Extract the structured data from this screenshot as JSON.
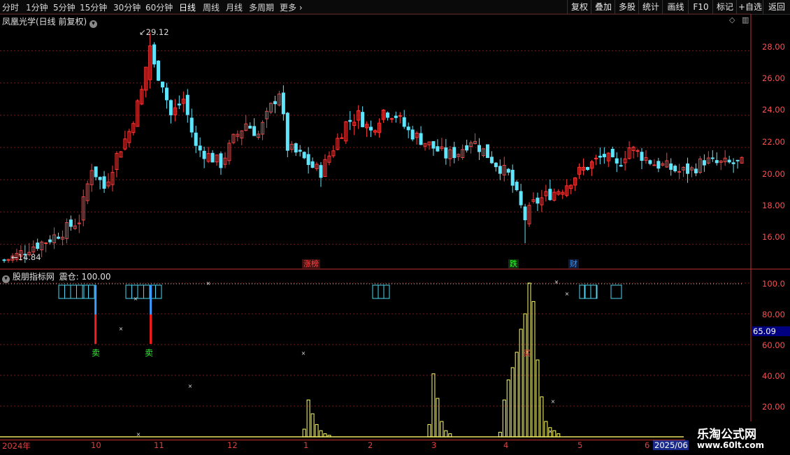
{
  "toolbar": {
    "timeframes": [
      "分时",
      "1分钟",
      "5分钟",
      "15分钟",
      "30分钟",
      "60分钟",
      "日线",
      "周线",
      "月线",
      "多周期"
    ],
    "more_label": "更多",
    "right_buttons": [
      "复权",
      "叠加",
      "多股",
      "统计",
      "画线",
      "F10",
      "标记",
      "+自选",
      "返回"
    ]
  },
  "price_panel": {
    "title": "凤凰光学(日线 前复权)",
    "high_label": "29.12",
    "low_label": "14.84",
    "yaxis": [
      "28.00",
      "26.00",
      "24.00",
      "22.00",
      "20.00",
      "18.00",
      "16.00"
    ],
    "tags": [
      {
        "text": "涨榜",
        "color": "#ff4444"
      },
      {
        "text": "跌",
        "color": "#33ff33"
      },
      {
        "text": "财",
        "color": "#3399ff"
      }
    ]
  },
  "indicator_panel": {
    "title": "股朋指标网",
    "value_label": "震仓: 100.00",
    "yaxis": [
      "100.0",
      "80.00",
      "60.00",
      "40.00",
      "20.00"
    ],
    "current_value": "65.09",
    "sell_label": "卖",
    "buy_label": "买"
  },
  "xaxis": {
    "labels": [
      "2024年",
      "10",
      "11",
      "12",
      "1",
      "2",
      "3",
      "4",
      "5",
      "6"
    ],
    "end_label": "2025/06"
  },
  "watermark": {
    "name": "乐淘公式网",
    "url": "www.60lt.com"
  },
  "chart_data": {
    "type": "candlestick",
    "price_range": [
      14.5,
      29.5
    ],
    "high": 29.12,
    "low": 14.84,
    "close_path": [
      [
        0,
        15.0
      ],
      [
        3,
        15.3
      ],
      [
        6,
        15.8
      ],
      [
        10,
        16.2
      ],
      [
        14,
        16.8
      ],
      [
        18,
        17.5
      ],
      [
        21,
        20.8
      ],
      [
        24,
        19.5
      ],
      [
        27,
        21.5
      ],
      [
        30,
        23.0
      ],
      [
        33,
        25.5
      ],
      [
        35,
        28.5
      ],
      [
        36,
        27.0
      ],
      [
        38,
        26.0
      ],
      [
        40,
        24.0
      ],
      [
        43,
        25.0
      ],
      [
        46,
        22.0
      ],
      [
        49,
        21.5
      ],
      [
        52,
        21.0
      ],
      [
        55,
        22.5
      ],
      [
        58,
        23.5
      ],
      [
        61,
        22.8
      ],
      [
        64,
        24.5
      ],
      [
        66,
        25.5
      ],
      [
        68,
        22.0
      ],
      [
        71,
        21.5
      ],
      [
        74,
        20.8
      ],
      [
        76,
        20.5
      ],
      [
        79,
        22.0
      ],
      [
        82,
        23.5
      ],
      [
        85,
        24.0
      ],
      [
        88,
        23.0
      ],
      [
        91,
        24.3
      ],
      [
        94,
        24.0
      ],
      [
        97,
        23.0
      ],
      [
        100,
        22.5
      ],
      [
        103,
        22.0
      ],
      [
        106,
        21.5
      ],
      [
        109,
        21.7
      ],
      [
        112,
        22.5
      ],
      [
        115,
        21.8
      ],
      [
        118,
        21.0
      ],
      [
        121,
        20.3
      ],
      [
        123,
        19.0
      ],
      [
        125,
        17.6
      ],
      [
        127,
        18.5
      ],
      [
        130,
        19.0
      ],
      [
        134,
        19.5
      ],
      [
        138,
        20.5
      ],
      [
        141,
        21.0
      ],
      [
        144,
        21.5
      ],
      [
        147,
        20.8
      ],
      [
        150,
        22.0
      ],
      [
        153,
        21.5
      ],
      [
        156,
        21.0
      ],
      [
        159,
        20.8
      ],
      [
        162,
        20.5
      ],
      [
        165,
        20.6
      ],
      [
        168,
        21.2
      ],
      [
        171,
        21.0
      ],
      [
        174,
        21.0
      ],
      [
        177,
        21.0
      ]
    ],
    "indicator": {
      "name": "震仓",
      "range": [
        0,
        100
      ],
      "current": 65.09,
      "last_value": 100.0,
      "sell_signals": [
        22,
        35
      ],
      "buy_signals": [
        127
      ],
      "bars": [
        [
          72,
          5
        ],
        [
          73,
          24
        ],
        [
          74,
          15
        ],
        [
          75,
          8
        ],
        [
          76,
          4
        ],
        [
          77,
          2
        ],
        [
          78,
          1
        ],
        [
          102,
          8
        ],
        [
          103,
          41
        ],
        [
          104,
          25
        ],
        [
          105,
          10
        ],
        [
          106,
          4
        ],
        [
          107,
          2
        ],
        [
          119,
          3
        ],
        [
          120,
          24
        ],
        [
          121,
          37
        ],
        [
          122,
          45
        ],
        [
          123,
          55
        ],
        [
          124,
          70
        ],
        [
          125,
          80
        ],
        [
          126,
          100
        ],
        [
          127,
          88
        ],
        [
          128,
          50
        ],
        [
          129,
          26
        ],
        [
          130,
          10
        ],
        [
          131,
          6
        ],
        [
          132,
          4
        ],
        [
          133,
          2
        ]
      ]
    }
  }
}
